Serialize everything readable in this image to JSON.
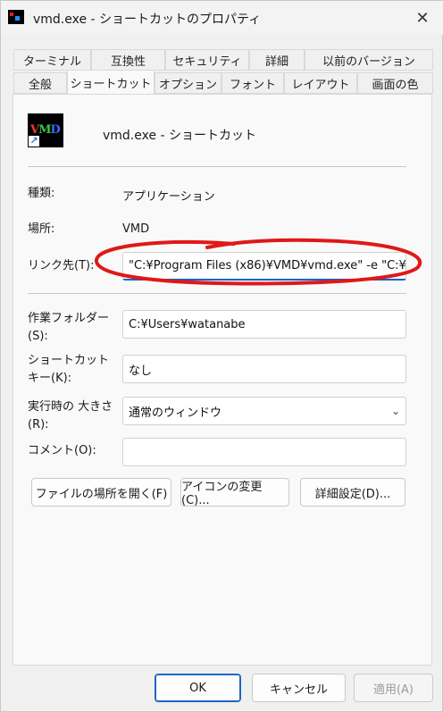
{
  "window": {
    "title": "vmd.exe - ショートカットのプロパティ"
  },
  "tabs_row1": [
    "ターミナル",
    "互換性",
    "セキュリティ",
    "詳細",
    "以前のバージョン"
  ],
  "tabs_row2": [
    "全般",
    "ショートカット",
    "オプション",
    "フォント",
    "レイアウト",
    "画面の色"
  ],
  "active_tab": "ショートカット",
  "header": {
    "shortcut_name": "vmd.exe - ショートカット",
    "icon_letters": [
      "V",
      "M",
      "D"
    ]
  },
  "fields": {
    "type_label": "種類:",
    "type_value": "アプリケーション",
    "location_label": "場所:",
    "location_value": "VMD",
    "target_label": "リンク先(T):",
    "target_value": "\"C:¥Program Files (x86)¥VMD¥vmd.exe\" -e \"C:¥",
    "startin_label": "作業フォルダー (S):",
    "startin_value": "C:¥Users¥watanabe",
    "hotkey_label": "ショートカット キー(K):",
    "hotkey_value": "なし",
    "run_label": "実行時の 大きさ(R):",
    "run_value": "通常のウィンドウ",
    "comment_label": "コメント(O):",
    "comment_value": ""
  },
  "buttons": {
    "open_location": "ファイルの場所を開く(F)",
    "change_icon": "アイコンの変更(C)...",
    "advanced": "詳細設定(D)...",
    "ok": "OK",
    "cancel": "キャンセル",
    "apply": "適用(A)"
  },
  "colors": {
    "accent": "#0a64c8",
    "annotation": "#e01818"
  }
}
